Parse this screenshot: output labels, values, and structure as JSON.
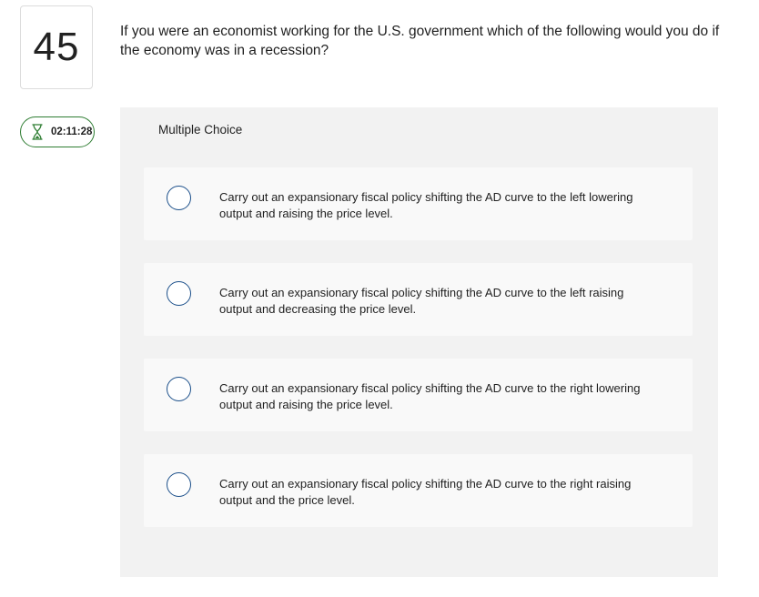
{
  "question": {
    "number": "45",
    "text": "If you were an economist working for the U.S. government which of the following would you do if the economy was in a recession?"
  },
  "timer": {
    "icon": "hourglass-icon",
    "value": "02:11:28",
    "color": "#2e7d32"
  },
  "answer_panel": {
    "label": "Multiple Choice",
    "choices": [
      {
        "text": "Carry out an expansionary fiscal policy shifting the AD curve to the left lowering output and raising the price level."
      },
      {
        "text": "Carry out an expansionary fiscal policy shifting the AD curve to the left raising output and decreasing the price level."
      },
      {
        "text": "Carry out an expansionary fiscal policy shifting the AD curve to the right lowering output and raising the price level."
      },
      {
        "text": "Carry out an expansionary fiscal policy shifting the AD curve to the right raising output and the price level."
      }
    ]
  },
  "colors": {
    "radio_border": "#1b4f8a",
    "panel_background": "#f2f2f2",
    "choice_background": "#f9f9f9"
  }
}
